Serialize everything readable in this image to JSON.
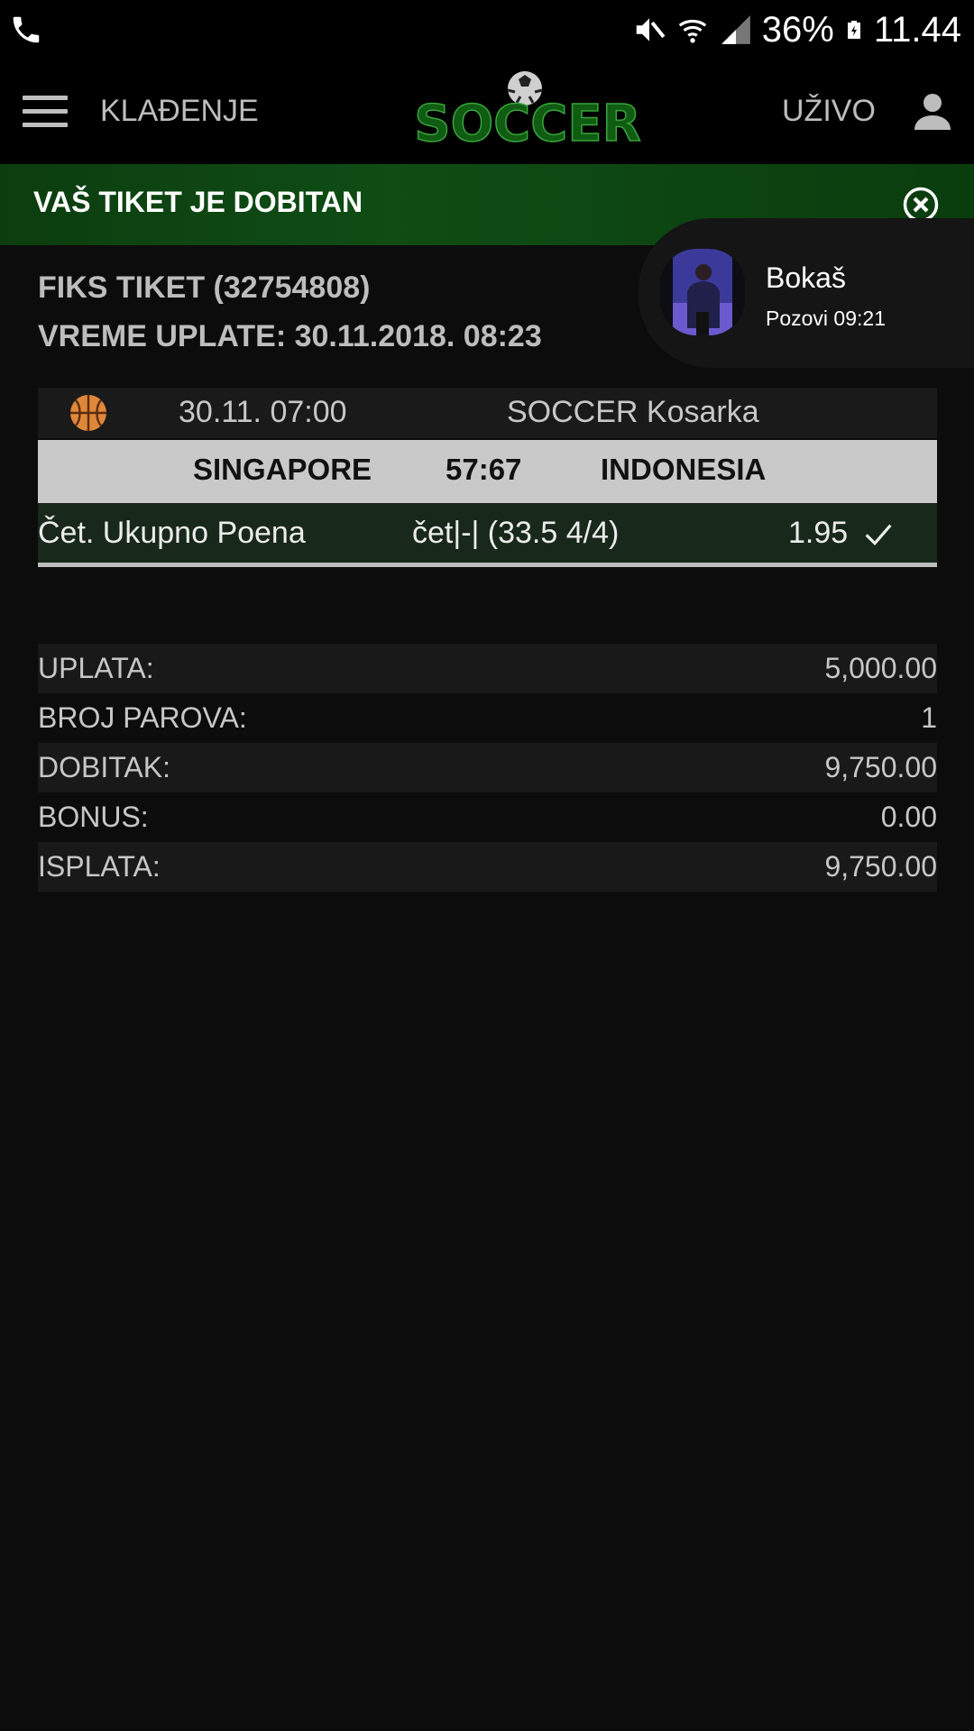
{
  "status_bar": {
    "battery": "36%",
    "time": "11.44",
    "icons": [
      "phone-icon",
      "mute-icon",
      "wifi-icon",
      "signal-icon",
      "battery-icon"
    ]
  },
  "header": {
    "betting_label": "KLAĐENJE",
    "logo_text": "SOCCER",
    "live_label": "UŽIVO",
    "icons": [
      "menu-icon",
      "user-icon"
    ]
  },
  "banner": {
    "title": "VAŠ TIKET JE DOBITAN",
    "close_icon": "close-circle-icon"
  },
  "ticket": {
    "title": "FIKS TIKET (32754808)",
    "payment_time": "VREME UPLATE: 30.11.2018. 08:23"
  },
  "call": {
    "name": "Bokaš",
    "subtitle": "Pozovi 09:21"
  },
  "event": {
    "sport_icon": "basketball-icon",
    "datetime": "30.11. 07:00",
    "league": "SOCCER Kosarka",
    "home_team": "SINGAPORE",
    "score": "57:67",
    "away_team": "INDONESIA",
    "market": "Čet. Ukupno Poena",
    "pick": "čet|-| (33.5 4/4)",
    "odd": "1.95",
    "status_icon": "check-icon"
  },
  "summary": [
    {
      "label": "UPLATA:",
      "value": "5,000.00"
    },
    {
      "label": "BROJ PAROVA:",
      "value": "1"
    },
    {
      "label": "DOBITAK:",
      "value": "9,750.00"
    },
    {
      "label": "BONUS:",
      "value": "0.00"
    },
    {
      "label": "ISPLATA:",
      "value": "9,750.00"
    }
  ],
  "colors": {
    "banner_green": "#0f4d14",
    "bet_row_green": "#18281a",
    "score_row": "#c9c9c9",
    "logo_green": "#1f7a1f"
  }
}
